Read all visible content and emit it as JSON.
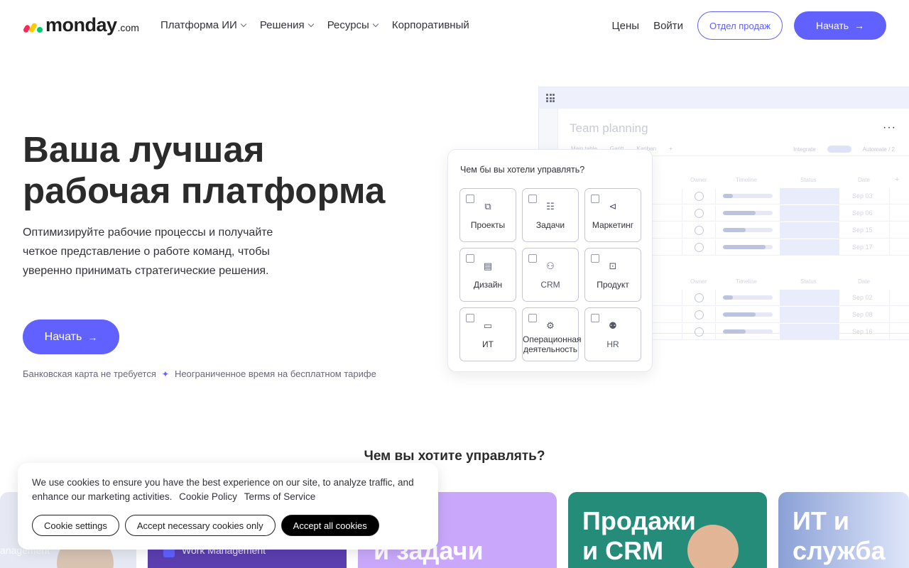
{
  "nav": {
    "logo_text": "monday",
    "logo_suffix": ".com",
    "links": [
      "Платформа ИИ",
      "Решения",
      "Ресурсы",
      "Корпоративный"
    ],
    "pricing": "Цены",
    "login": "Войти",
    "sales": "Отдел продаж",
    "start": "Начать"
  },
  "hero": {
    "title_line1": "Ваша лучшая",
    "title_line2": "рабочая платформа",
    "subtitle": "Оптимизируйте рабочие процессы и получайте четкое представление о работе команд, чтобы уверенно принимать стратегические решения.",
    "cta": "Начать",
    "note1": "Банковская карта не требуется",
    "note_sep": "✦",
    "note2": "Неограниченное время на бесплатном тарифе"
  },
  "board": {
    "title": "Team planning",
    "tabs": [
      "Main table",
      "Gantt",
      "Kanban",
      "+"
    ],
    "right_tabs": [
      "Integrate",
      "Automate / 2"
    ],
    "columns": [
      "Owner",
      "Timeline",
      "Status",
      "Date"
    ],
    "group1": [
      {
        "date": "Sep 03",
        "progress": 0.2
      },
      {
        "date": "Sep 06",
        "progress": 0.65
      },
      {
        "date": "Sep 15",
        "progress": 0.45
      },
      {
        "date": "Sep 17",
        "progress": 0.85
      }
    ],
    "group2": [
      {
        "date": "Sep 02",
        "progress": 0.2
      },
      {
        "date": "Sep 08",
        "progress": 0.65
      },
      {
        "date": "Sep 16",
        "progress": 0.45
      }
    ]
  },
  "picker": {
    "title": "Чем бы вы хотели управлять?",
    "tiles": [
      {
        "label": "Проекты",
        "icon": "folders-icon"
      },
      {
        "label": "Задачи",
        "icon": "checklist-icon"
      },
      {
        "label": "Маркетинг",
        "icon": "megaphone-icon"
      },
      {
        "label": "Дизайн",
        "icon": "design-icon"
      },
      {
        "label": "CRM",
        "icon": "crm-icon"
      },
      {
        "label": "Продукт",
        "icon": "product-icon"
      },
      {
        "label": "ИТ",
        "icon": "laptop-icon"
      },
      {
        "label": "Операционная деятельность",
        "icon": "gear-icon"
      },
      {
        "label": "HR",
        "icon": "people-icon"
      }
    ]
  },
  "section": {
    "title": "Чем вы хотите управлять?"
  },
  "cards": {
    "card1_small": "anagement",
    "card2_small": "Work Management",
    "card3_head": "екты\nи задачи",
    "card4_head": "Продажи\nи CRM",
    "card5_head": "ИТ и\nслужба"
  },
  "cookie": {
    "text": "We use cookies to ensure you have the best experience on our site, to analyze traffic, and enhance our marketing activities.",
    "policy_link": "Cookie Policy",
    "terms_link": "Terms of Service",
    "settings": "Cookie settings",
    "necessary": "Accept necessary cookies only",
    "accept_all": "Accept all cookies"
  },
  "colors": {
    "brand": "#6161ff",
    "text": "#323338"
  }
}
